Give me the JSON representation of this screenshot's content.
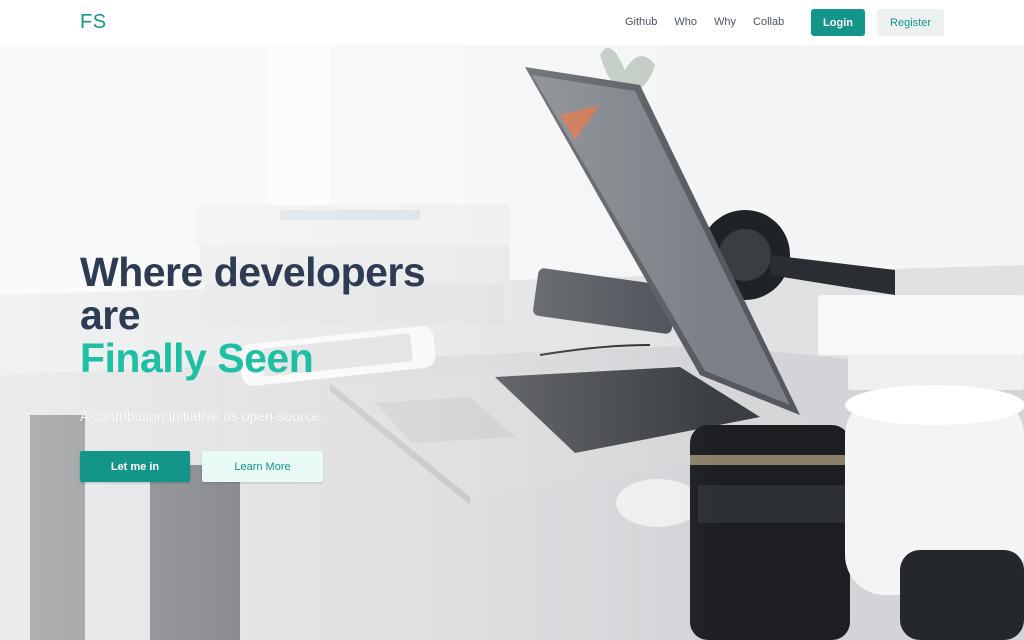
{
  "nav": {
    "logo": "FS",
    "links": [
      "Github",
      "Who",
      "Why",
      "Collab"
    ],
    "login_label": "Login",
    "register_label": "Register"
  },
  "hero": {
    "headline_line1": "Where developers",
    "headline_line2": "are",
    "headline_accent": "Finally Seen",
    "subtitle": "A contribution initiative as open-source.",
    "primary_button": "Let me in",
    "secondary_button": "Learn More",
    "background_image": "desk-with-laptop-photo"
  },
  "colors": {
    "brand": "#14958a",
    "accent_text": "#1fbfa4",
    "headline": "#2f3b52"
  }
}
